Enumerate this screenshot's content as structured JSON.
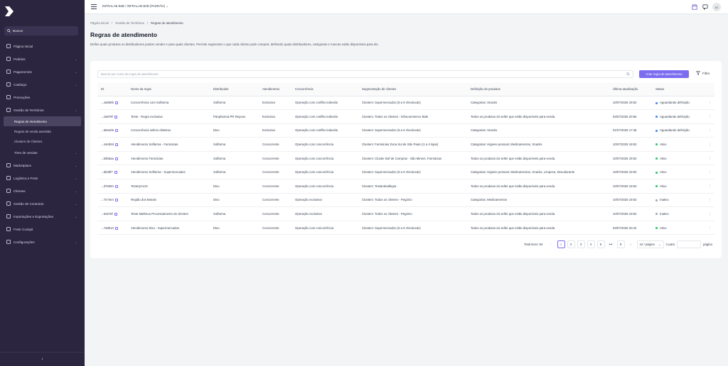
{
  "sidebar": {
    "search_label": "Buscar",
    "items": [
      {
        "label": "Página inicial",
        "icon": "home-icon",
        "chevron": false
      },
      {
        "label": "Pedidos",
        "icon": "box-icon",
        "chevron": true
      },
      {
        "label": "Pagamentos",
        "icon": "dollar-icon",
        "chevron": true
      },
      {
        "label": "Catálogo",
        "icon": "tag-icon",
        "chevron": true
      },
      {
        "label": "Promoções",
        "icon": "percent-icon",
        "chevron": false
      },
      {
        "label": "Gestão de Territórios",
        "icon": "map-pin-icon",
        "chevron": true
      }
    ],
    "subitems": [
      "Regras de Atendimento",
      "Regras de venda assistida",
      "Clusters de Clientes"
    ],
    "items2": [
      {
        "label": "Time de vendas",
        "chevron": true
      },
      {
        "label": "Marketplace",
        "chevron": true
      },
      {
        "label": "Logística e Frete",
        "chevron": true
      },
      {
        "label": "Clientes",
        "chevron": true
      },
      {
        "label": "Gestão de Conteúdo",
        "chevron": true
      },
      {
        "label": "Importações e Exportações",
        "chevron": true
      },
      {
        "label": "Frete Cockpit",
        "chevron": false
      },
      {
        "label": "Configurações",
        "chevron": true
      }
    ],
    "collapse_glyph": "‹"
  },
  "topbar": {
    "org": "INFRALAB B2B / INFRALAB B2B (PADRÃO)",
    "avatar": "IG"
  },
  "breadcrumb": [
    "Página inicial",
    "Gestão de Territórios",
    "Regras de atendimento"
  ],
  "page": {
    "title": "Regras de atendimento",
    "description": "Define quais produtos os distribuidores podem vender e para quais clientes. Permite segmentar o que cada cliente pode comprar, definindo quais distribuidores, categorias e marcas estão disponíveis para ele."
  },
  "toolbar": {
    "search_placeholder": "Buscar por nome da regra de atendimento",
    "create_label": "Criar regra de atendimento",
    "filter_label": "Filtro"
  },
  "table": {
    "headers": [
      "ID",
      "Nome da regra",
      "Distribuidor",
      "Atendimento",
      "Concorrência",
      "Segmentação de clientes",
      "Definição de produtos",
      "Última atualização",
      "Status"
    ],
    "rows": [
      [
        "...4a9b0b",
        "Concorrência com Solfarma",
        "Solfarma",
        "Exclusivo",
        "Operação com conflito indevido",
        "Clusters: Supermercados (5 a 9 checkouts)",
        "Categorias: Snacks",
        "10/07/2025 19:53",
        "Aguardando definição"
      ],
      [
        "...16879f",
        "Teste - Regra exclusiva",
        "Panpharma PR Repoxs",
        "Exclusivo",
        "Operação com conflito indevido",
        "Clusters: Todos os clientes - Infracommerce B2B",
        "Todos os produtos do seller que estão disponíveis para venda.",
        "03/07/2025 20:55",
        "Aguardando definição"
      ],
      [
        "...584e09",
        "Concorrência sellers distintos",
        "Diso",
        "Exclusivo",
        "Operação com conflito indevido",
        "Clusters: Supermercados (5 a 9 checkouts)",
        "Categorias: Snacks",
        "01/07/2025 17:48",
        "Aguardando definição"
      ],
      [
        "...44eb0d",
        "Atendimento Solfarma - Farmácias",
        "Solfarma",
        "Concorrente",
        "Operação com concorrência",
        "Clusters: Farmácias Zona Sul de São Paulo (1 a 4 lojas)",
        "Categorias: Higiene pessoal, Medicamentos, Snacks",
        "10/07/2025 19:53",
        "Ativo"
      ],
      [
        "...b0b5aa",
        "Atendimento Farmácias",
        "Solfarma",
        "Concorrente",
        "Operação com concorrência",
        "Clusters: Cluster Bof de Compras - São Miners, Farmácias",
        "Todos os produtos do seller que estão disponíveis para venda.",
        "10/07/2025 19:53",
        "Ativo"
      ],
      [
        "...5b38f7",
        "Atendimento Solfarma - Supermercados",
        "Solfarma",
        "Concorrente",
        "Operação com concorrência",
        "Clusters: Supermercados (5 a 9 checkouts)",
        "Categorias: Higiene pessoal, Medicamentos, Snacks, Limpeza, Desodorante",
        "10/07/2025 19:53",
        "Ativo"
      ],
      [
        "...d76084",
        "TesteQA123",
        "Diso",
        "Concorrente",
        "Operação com concorrência",
        "Clusters: Testandoallegra",
        "Todos os produtos do seller que estão disponíveis para venda.",
        "10/07/2025 19:53",
        "Ativo"
      ],
      [
        "...7e74e4",
        "Região dos Marais",
        "Diso",
        "Concorrente",
        "Operação exclusiva",
        "Clusters: Todos os clientes - Peg2Go",
        "Categorias: Medicamentos",
        "10/07/2025 19:53",
        "Inativo"
      ],
      [
        "...91576f",
        "Teste Matheus Processamento de clientes",
        "Solfarma",
        "Concorrente",
        "Operação exclusiva",
        "Clusters: Todos os clientes - Peg2Go",
        "Todos os produtos do seller que estão disponíveis para venda.",
        "10/07/2025 19:53",
        "Inativo"
      ],
      [
        "...7a8b13",
        "Atendimento Diso - Supermercados",
        "Diso",
        "Concorrente",
        "Operação com concorrência",
        "Clusters: Supermercados (5 a 9 checkouts)",
        "Todos os produtos do seller que estão disponíveis para venda.",
        "03/07/2025 20:42",
        "Ativo"
      ]
    ],
    "status_colors": {
      "Aguardando definição": "#3b82f6",
      "Ativo": "#22c55e",
      "Inativo": "#9ca3af"
    },
    "more_glyph": "⋮"
  },
  "pagination": {
    "total": "Total itens: 84",
    "pages": [
      "1",
      "2",
      "3",
      "4",
      "5",
      "•••",
      "9"
    ],
    "page_size": "10 / página",
    "goto_label": "Ir para",
    "goto_suffix": "página"
  },
  "colors": {
    "sidebar_bg": "#2b2540",
    "accent": "#7c6cf0"
  }
}
